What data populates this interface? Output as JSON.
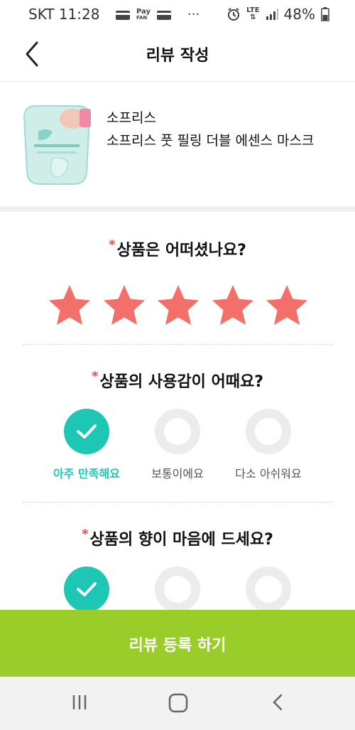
{
  "status_bar": {
    "carrier_time": "SKT 11:28",
    "pay_text": "Pay",
    "pay_sub": "FAN",
    "more": "···",
    "lte": "LTE",
    "battery": "48%"
  },
  "header": {
    "title": "리뷰 작성"
  },
  "product": {
    "brand": "소프리스",
    "name": "소프리스 풋 필링 더블 에센스 마스크"
  },
  "rating": {
    "required_mark": "*",
    "question": "상품은 어떠셨나요?",
    "stars_selected": 5,
    "stars_total": 5,
    "star_color": "#f27069"
  },
  "usage": {
    "required_mark": "*",
    "question": "상품의 사용감이 어때요?",
    "options": [
      "아주 만족해요",
      "보통이에요",
      "다소 아쉬워요"
    ],
    "selected_index": 0
  },
  "scent": {
    "required_mark": "*",
    "question": "상품의 향이 마음에 드세요?",
    "selected_index": 0
  },
  "submit": {
    "label": "리뷰 등록 하기",
    "color": "#9acd2a"
  },
  "colors": {
    "accent": "#1ec7b3",
    "required": "#e74c3c"
  }
}
